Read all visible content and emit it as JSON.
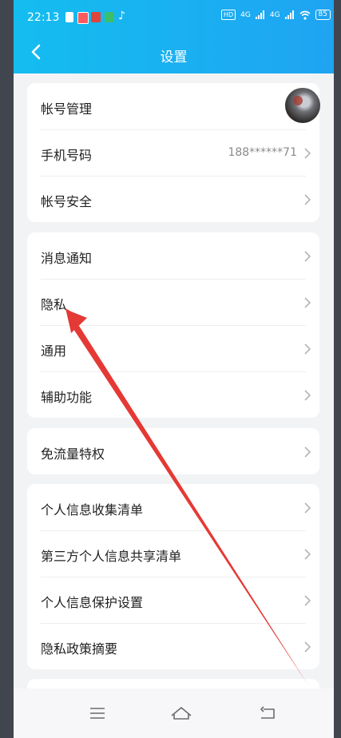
{
  "status_bar": {
    "time": "22:13",
    "network_chip": "HD",
    "signal_1": "4G",
    "signal_2": "4G",
    "battery": "85"
  },
  "header": {
    "title": "设置"
  },
  "groups": [
    {
      "rows": [
        {
          "label": "帐号管理",
          "value": "",
          "kind": "avatar"
        },
        {
          "label": "手机号码",
          "value": "188******71",
          "kind": "value"
        },
        {
          "label": "帐号安全",
          "value": "",
          "kind": "chevron"
        }
      ]
    },
    {
      "rows": [
        {
          "label": "消息通知"
        },
        {
          "label": "隐私"
        },
        {
          "label": "通用"
        },
        {
          "label": "辅助功能"
        }
      ]
    },
    {
      "rows": [
        {
          "label": "免流量特权"
        }
      ]
    },
    {
      "rows": [
        {
          "label": "个人信息收集清单"
        },
        {
          "label": "第三方个人信息共享清单"
        },
        {
          "label": "个人信息保护设置"
        },
        {
          "label": "隐私政策摘要"
        }
      ]
    }
  ],
  "annotation": {
    "type": "arrow",
    "color": "#e53935",
    "points_to": "隐私"
  },
  "icons": {
    "back": "back-arrow-icon",
    "nav_menu": "menu-icon",
    "nav_home": "home-icon",
    "nav_back": "back-icon"
  },
  "colors": {
    "header_start": "#14bdf0",
    "header_end": "#1fa4f2",
    "page_bg": "#f2f3f5",
    "annotation": "#e53935"
  }
}
